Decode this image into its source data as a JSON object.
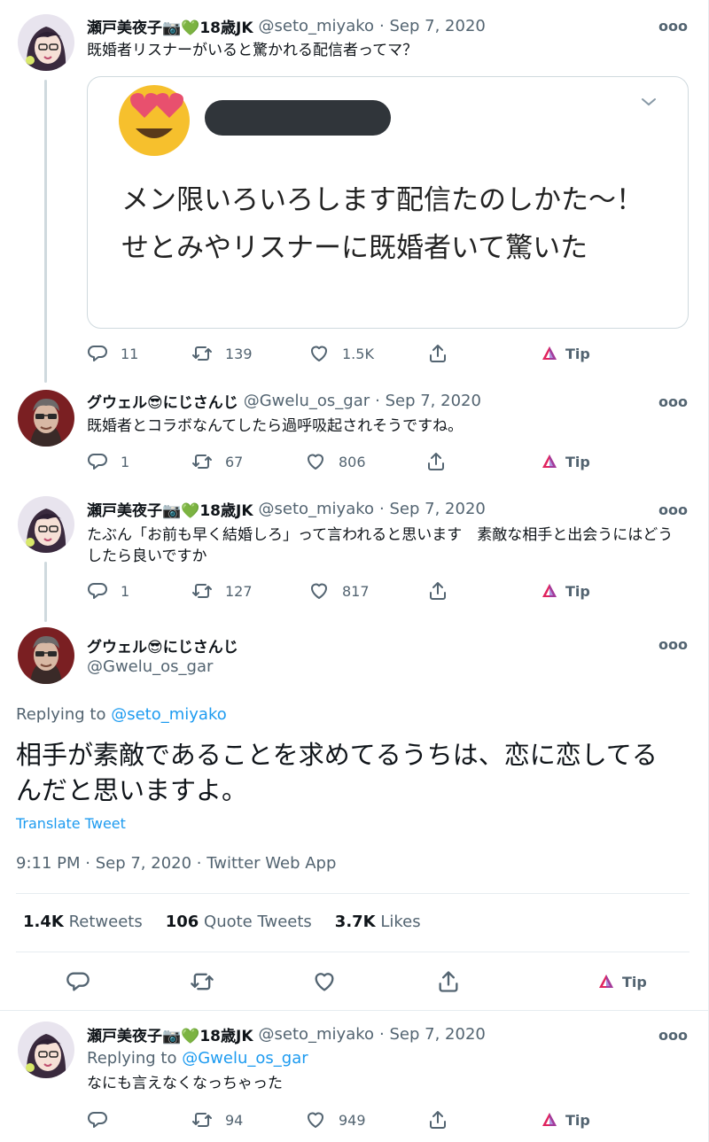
{
  "tweets": [
    {
      "name": "瀬戸美夜子📷💚18歳JK",
      "handle": "@seto_miyako",
      "date": "· Sep 7, 2020",
      "text": "既婚者リスナーがいると驚かれる配信者ってマ？",
      "replies": "11",
      "retweets": "139",
      "likes": "1.5K",
      "tip": "Tip"
    },
    {
      "name": "グウェル😎にじさんじ",
      "handle": "@Gwelu_os_gar",
      "date": "· Sep 7, 2020",
      "text": "既婚者とコラボなんてしたら過呼吸起されそうですね。",
      "replies": "1",
      "retweets": "67",
      "likes": "806",
      "tip": "Tip"
    },
    {
      "name": "瀬戸美夜子📷💚18歳JK",
      "handle": "@seto_miyako",
      "date": "· Sep 7, 2020",
      "text": "たぶん「お前も早く結婚しろ」って言われると思います　素敵な相手と出会うにはどうしたら良いですか",
      "replies": "1",
      "retweets": "127",
      "likes": "817",
      "tip": "Tip"
    }
  ],
  "quote": {
    "text": "メン限いろいろします配信たのしかた〜！せとみやリスナーに既婚者いて驚いた",
    "caret_icon": "chevron-down-icon"
  },
  "main_tweet": {
    "name": "グウェル😎にじさんじ",
    "handle": "@Gwelu_os_gar",
    "replying_label": "Replying to",
    "replying_to": "@seto_miyako",
    "text": "相手が素敵であることを求めてるうちは、恋に恋してるんだと思いますよ。",
    "translate": "Translate Tweet",
    "timestamp": "9:11 PM · Sep 7, 2020 · Twitter Web App",
    "stats": {
      "retweets_count": "1.4K",
      "retweets_label": "Retweets",
      "quotes_count": "106",
      "quotes_label": "Quote Tweets",
      "likes_count": "3.7K",
      "likes_label": "Likes"
    },
    "tip": "Tip"
  },
  "reply_tweet": {
    "name": "瀬戸美夜子📷💚18歳JK",
    "handle": "@seto_miyako",
    "date": "· Sep 7, 2020",
    "replying_label": "Replying to",
    "replying_to": "@Gwelu_os_gar",
    "text": "なにも言えなくなっちゃった",
    "retweets": "94",
    "likes": "949",
    "tip": "Tip"
  },
  "more_label": "ooo",
  "colors": {
    "accent": "#1d9bf0",
    "text": "#0f1419",
    "muted": "#536471",
    "border": "#cfd9de"
  }
}
